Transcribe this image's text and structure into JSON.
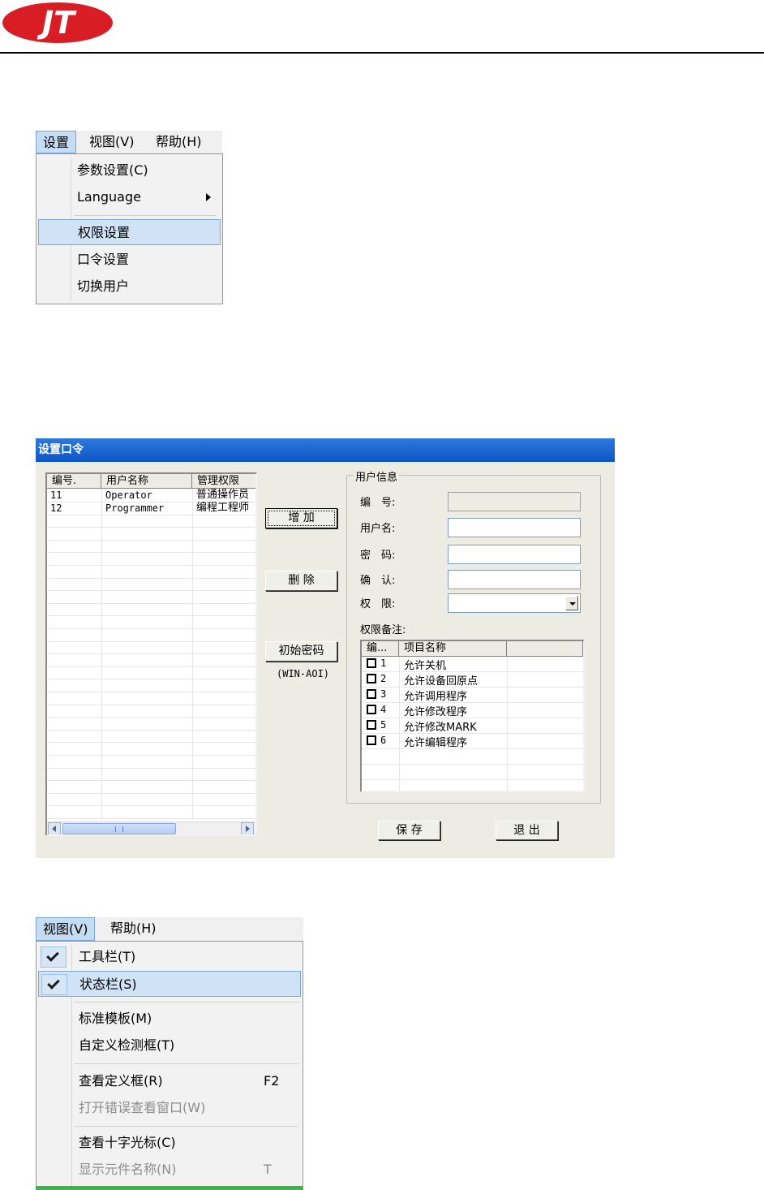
{
  "logo": {
    "text": "JT",
    "color": "#d81e24"
  },
  "menu1": {
    "bar": [
      "设置",
      "视图(V)",
      "帮助(H)"
    ],
    "items": [
      {
        "label": "参数设置(C)"
      },
      {
        "label": "Language"
      },
      {
        "label": "权限设置"
      },
      {
        "label": "口令设置"
      },
      {
        "label": "切换用户"
      }
    ]
  },
  "dialog": {
    "title": "设置口令",
    "user_list": {
      "columns": [
        "编号.",
        "用户名称",
        "管理权限"
      ],
      "rows": [
        {
          "id": "11",
          "name": "Operator",
          "role": "普通操作员"
        },
        {
          "id": "12",
          "name": "Programmer",
          "role": "编程工程师"
        }
      ],
      "scroll_grip": "III"
    },
    "buttons": {
      "add": "增 加",
      "delete": "删 除",
      "reset": "初始密码",
      "reset_note": "(WIN-AOI)",
      "save": "保 存",
      "exit": "退 出"
    },
    "user_info": {
      "group_title": "用户信息",
      "id_label": "编　号:",
      "username_label": "用户名:",
      "password_label": "密　码:",
      "confirm_label": "确　认:",
      "permission_label": "权　限:",
      "id_value": "",
      "username_value": "",
      "password_value": "",
      "confirm_value": "",
      "permission_value": "",
      "remarks_label": "权限备注:"
    },
    "perm_list": {
      "columns": [
        "编...",
        "项目名称",
        ""
      ],
      "rows": [
        {
          "num": "1",
          "name": "允许关机"
        },
        {
          "num": "2",
          "name": "允许设备回原点"
        },
        {
          "num": "3",
          "name": "允许调用程序"
        },
        {
          "num": "4",
          "name": "允许修改程序"
        },
        {
          "num": "5",
          "name": "允许修改MARK"
        },
        {
          "num": "6",
          "name": "允许编辑程序"
        }
      ]
    }
  },
  "menu2": {
    "bar": [
      "视图(V)",
      "帮助(H)"
    ],
    "items": [
      {
        "label": "工具栏(T)",
        "checked": true
      },
      {
        "label": "状态栏(S)",
        "checked": true
      },
      {
        "label": "标准模板(M)"
      },
      {
        "label": "自定义检测框(T)"
      },
      {
        "label": "查看定义框(R)",
        "shortcut": "F2"
      },
      {
        "label": "打开错误查看窗口(W)",
        "disabled": true
      },
      {
        "label": "查看十字光标(C)"
      },
      {
        "label": "显示元件名称(N)",
        "shortcut": "T",
        "disabled": true
      }
    ]
  }
}
